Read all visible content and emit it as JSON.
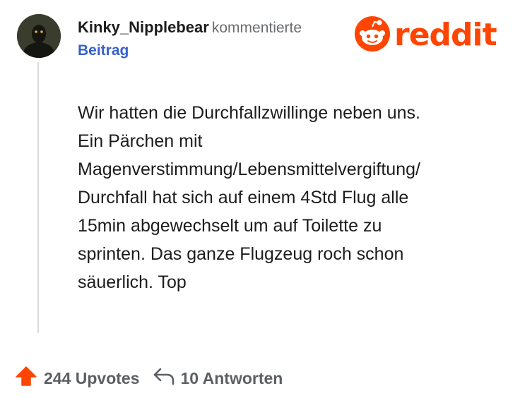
{
  "post": {
    "username": "Kinky_Nipplebear",
    "verb": "kommentierte",
    "link_label": "Beitrag"
  },
  "brand": {
    "name": "reddit",
    "color": "#ff4500",
    "icon": "reddit-snoo-icon"
  },
  "comment": {
    "lines": [
      "Wir hatten die Durchfallzwillinge neben uns.",
      "Ein Pärchen mit",
      "Magenverstimmung/Lebensmittelvergiftung/",
      "Durchfall hat sich auf einem 4Std Flug alle",
      "15min abgewechselt um auf Toilette zu",
      "sprinten. Das ganze Flugzeug roch schon",
      "säuerlich. Top"
    ]
  },
  "footer": {
    "upvotes_label": "244 Upvotes",
    "replies_label": "10 Antworten",
    "upvote_icon": "upvote-arrow-icon",
    "reply_icon": "reply-arrow-icon",
    "upvote_color": "#ff4500"
  }
}
